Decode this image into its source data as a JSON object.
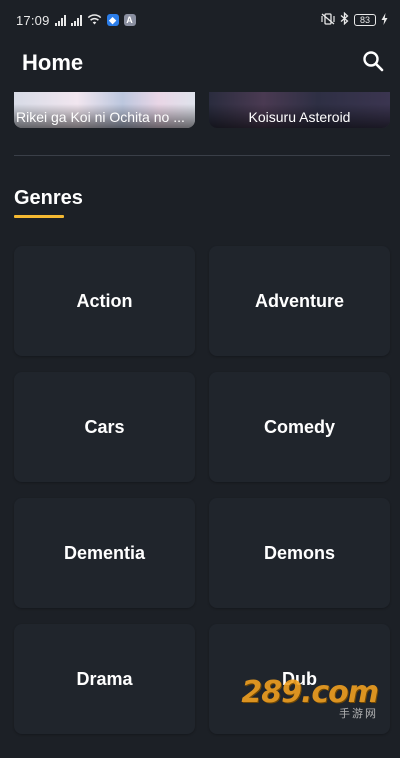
{
  "status_bar": {
    "time": "17:09",
    "battery": "83"
  },
  "app_bar": {
    "title": "Home"
  },
  "featured": [
    {
      "title": "Rikei ga Koi ni Ochita no ..."
    },
    {
      "title": "Koisuru Asteroid"
    }
  ],
  "genres": {
    "heading": "Genres",
    "accent_color": "#f5b932",
    "items": [
      {
        "label": "Action"
      },
      {
        "label": "Adventure"
      },
      {
        "label": "Cars"
      },
      {
        "label": "Comedy"
      },
      {
        "label": "Dementia"
      },
      {
        "label": "Demons"
      },
      {
        "label": "Drama"
      },
      {
        "label": "Dub"
      }
    ]
  },
  "watermark": {
    "main": "289.com",
    "sub": "手游网"
  }
}
